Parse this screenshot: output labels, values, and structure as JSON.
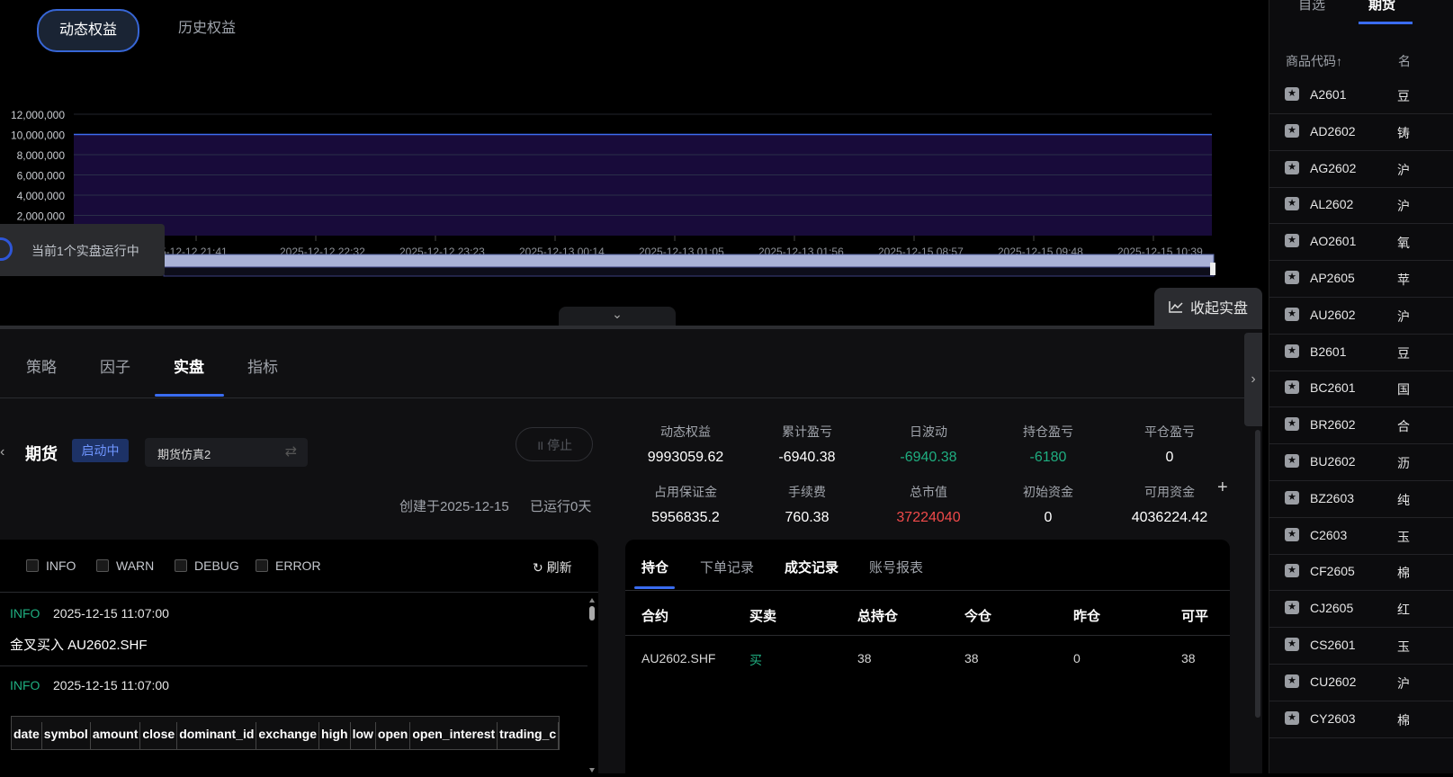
{
  "top_tabs": {
    "dynamic": "动态权益",
    "history": "历史权益"
  },
  "chart_data": {
    "type": "area",
    "x": [
      "2025-12-12 21:41",
      "2025-12-12 22:32",
      "2025-12-12 23:23",
      "2025-12-13 00:14",
      "2025-12-13 01:05",
      "2025-12-13 01:56",
      "2025-12-15 08:57",
      "2025-12-15 09:48",
      "2025-12-15 10:39"
    ],
    "x_tick_labels": [
      "5-12-12 21:41",
      "2025-12-12 22:32",
      "2025-12-12 23:23",
      "2025-12-13 00:14",
      "2025-12-13 01:05",
      "2025-12-13 01:56",
      "2025-12-15 08:57",
      "2025-12-15 09:48",
      "2025-12-15 10:39"
    ],
    "y_tick_labels": [
      "12,000,000",
      "10,000,000",
      "8,000,000",
      "6,000,000",
      "4,000,000",
      "2,000,000"
    ],
    "series": [
      {
        "values": [
          10000000,
          10000000,
          10000000,
          10000000,
          10000000,
          10000000,
          10000000,
          9999000,
          9993059.62
        ]
      }
    ],
    "ylim": [
      0,
      12000000
    ],
    "grid": true,
    "line_color": "#3d6cf0",
    "fill_color": "#1c0d44"
  },
  "running_status": "当前1个实盘运行中",
  "collapse_live": "收起实盘",
  "main_tabs": [
    "策略",
    "因子",
    "实盘",
    "指标"
  ],
  "strategy": {
    "type": "期货",
    "status": "启动中",
    "account": "期货仿真2",
    "stop": "停止",
    "created": "创建于2025-12-15",
    "runtime": "已运行0天"
  },
  "metrics": [
    {
      "label": "动态权益",
      "value": "9993059.62",
      "color": "#ffffff"
    },
    {
      "label": "累计盈亏",
      "value": "-6940.38",
      "color": "#ffffff"
    },
    {
      "label": "日波动",
      "value": "-6940.38",
      "color": "#1fae80"
    },
    {
      "label": "持仓盈亏",
      "value": "-6180",
      "color": "#1fae80"
    },
    {
      "label": "平仓盈亏",
      "value": "0",
      "color": "#ffffff"
    },
    {
      "label": "占用保证金",
      "value": "5956835.2",
      "color": "#ffffff"
    },
    {
      "label": "手续费",
      "value": "760.38",
      "color": "#ffffff"
    },
    {
      "label": "总市值",
      "value": "37224040",
      "color": "#f04a4a"
    },
    {
      "label": "初始资金",
      "value": "0",
      "color": "#ffffff"
    },
    {
      "label": "可用资金",
      "value": "4036224.42",
      "color": "#ffffff"
    }
  ],
  "log": {
    "levels": [
      "INFO",
      "WARN",
      "DEBUG",
      "ERROR"
    ],
    "refresh": "刷新",
    "entries": [
      {
        "level": "INFO",
        "time": "2025-12-15 11:07:00",
        "msg": "金叉买入 AU2602.SHF"
      },
      {
        "level": "INFO",
        "time": "2025-12-15 11:07:00",
        "msg": ""
      }
    ],
    "table_columns": [
      "date",
      "symbol",
      "amount",
      "close",
      "dominant_id",
      "exchange",
      "high",
      "low",
      "open",
      "open_interest",
      "trading_c"
    ]
  },
  "positions": {
    "tabs": [
      "持仓",
      "下单记录",
      "成交记录",
      "账号报表"
    ],
    "columns": [
      "合约",
      "买卖",
      "总持仓",
      "今仓",
      "昨仓",
      "可平"
    ],
    "rows": [
      {
        "contract": "AU2602.SHF",
        "side": "买",
        "total": "38",
        "today": "38",
        "yesterday": "0",
        "closable": "38"
      }
    ]
  },
  "watchlist": {
    "tabs": [
      "自选",
      "期货"
    ],
    "head_code": "商品代码↑",
    "head_name": "名",
    "items": [
      {
        "code": "A2601",
        "name": "豆"
      },
      {
        "code": "AD2602",
        "name": "铸"
      },
      {
        "code": "AG2602",
        "name": "沪"
      },
      {
        "code": "AL2602",
        "name": "沪"
      },
      {
        "code": "AO2601",
        "name": "氧"
      },
      {
        "code": "AP2605",
        "name": "苹"
      },
      {
        "code": "AU2602",
        "name": "沪"
      },
      {
        "code": "B2601",
        "name": "豆"
      },
      {
        "code": "BC2601",
        "name": "国"
      },
      {
        "code": "BR2602",
        "name": "合"
      },
      {
        "code": "BU2602",
        "name": "沥"
      },
      {
        "code": "BZ2603",
        "name": "纯"
      },
      {
        "code": "C2603",
        "name": "玉"
      },
      {
        "code": "CF2605",
        "name": "棉"
      },
      {
        "code": "CJ2605",
        "name": "红"
      },
      {
        "code": "CS2601",
        "name": "玉"
      },
      {
        "code": "CU2602",
        "name": "沪"
      },
      {
        "code": "CY2603",
        "name": "棉"
      }
    ]
  }
}
